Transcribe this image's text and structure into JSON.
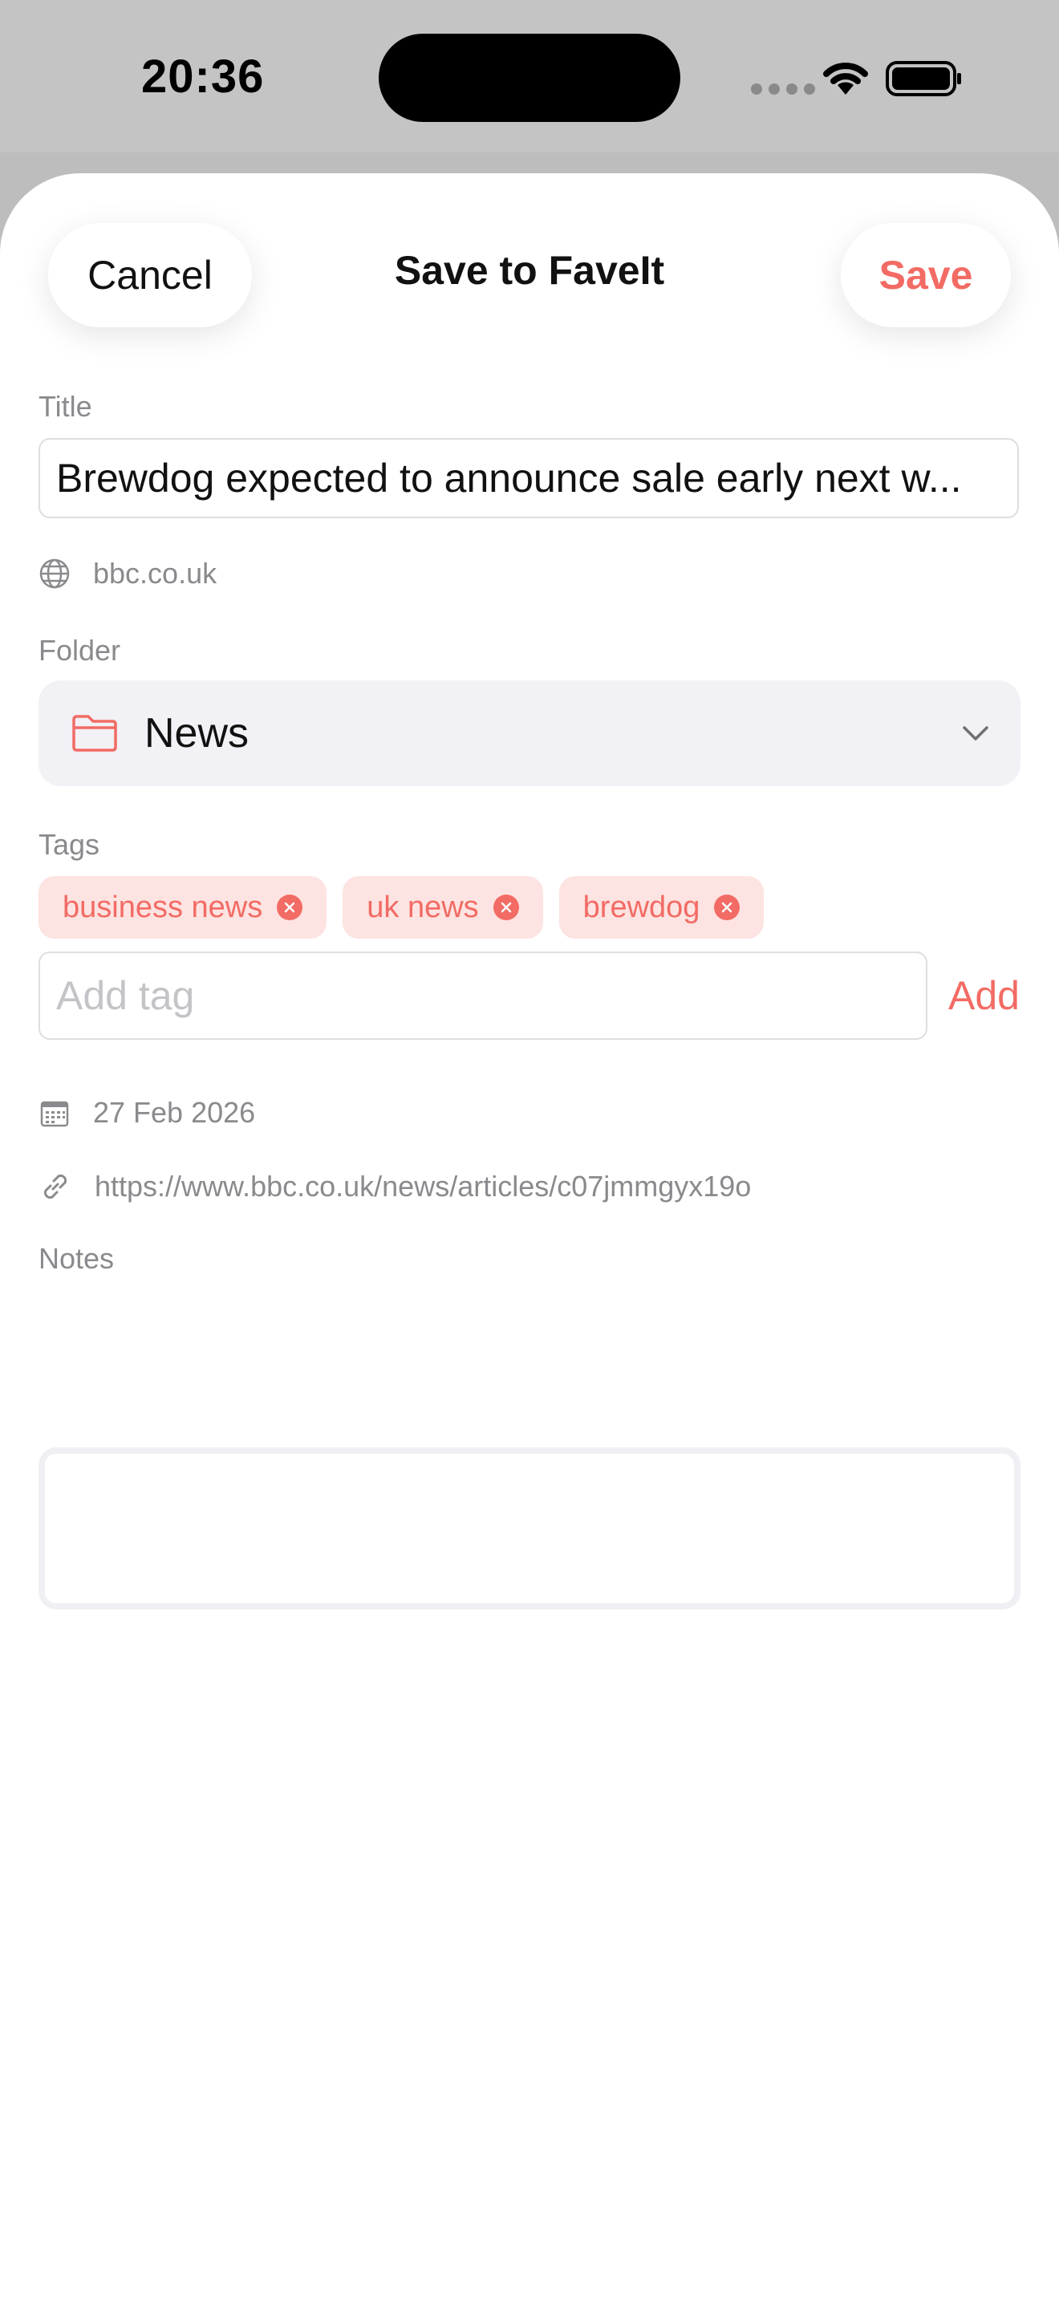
{
  "status_bar": {
    "time": "20:36"
  },
  "sheet": {
    "title": "Save to FaveIt",
    "cancel_label": "Cancel",
    "save_label": "Save"
  },
  "form": {
    "title_label": "Title",
    "title_value": "Brewdog expected to announce sale early next w...",
    "domain": "bbc.co.uk",
    "folder_label": "Folder",
    "folder_value": "News",
    "tags_label": "Tags",
    "tags": [
      "business news",
      "uk news",
      "brewdog"
    ],
    "tag_input_placeholder": "Add tag",
    "add_label": "Add",
    "date": "27 Feb 2026",
    "url": "https://www.bbc.co.uk/news/articles/c07jmmgyx19o",
    "notes_label": "Notes",
    "notes_value": ""
  },
  "icons": {
    "globe": "globe-icon",
    "folder": "folder-icon",
    "chevron": "chevron-down-icon",
    "calendar": "calendar-icon",
    "link": "link-icon",
    "tag_remove": "remove-tag-icon"
  },
  "colors": {
    "accent": "#f26b64",
    "tag_background": "#fde3e1",
    "secondary_text": "#8a8a8e"
  }
}
